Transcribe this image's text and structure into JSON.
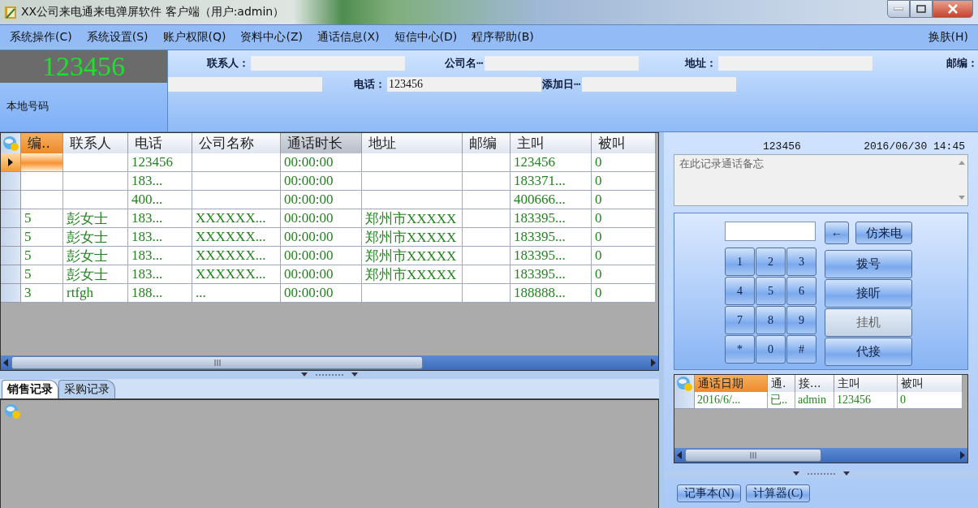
{
  "window": {
    "title": "XX公司来电通来电弹屏软件 客户端（用户:admin）"
  },
  "menu": {
    "items": [
      "系统操作(C)",
      "系统设置(S)",
      "账户权限(Q)",
      "资料中心(Z)",
      "通话信息(X)",
      "短信中心(D)",
      "程序帮助(B)"
    ],
    "skin": "换肤(H)"
  },
  "caller": {
    "number": "123456",
    "label": "本地号码"
  },
  "contact_form": {
    "rows": [
      [
        {
          "kind": "labeled",
          "label": "联系人："
        },
        {
          "kind": "labeled",
          "label": "公司名┅"
        },
        {
          "kind": "labeled",
          "label": "地址："
        },
        {
          "kind": "label",
          "label": "邮编："
        }
      ],
      [
        {
          "kind": "field"
        },
        {
          "kind": "labeled",
          "label": "电话：",
          "value": "123456"
        },
        {
          "kind": "labeled",
          "label": "添加日┅"
        }
      ]
    ]
  },
  "calls_table": {
    "columns": [
      {
        "label": "编..",
        "selected": true,
        "sorted": false
      },
      {
        "label": "联系人",
        "selected": false,
        "sorted": false
      },
      {
        "label": "电话",
        "selected": false,
        "sorted": false
      },
      {
        "label": "公司名称",
        "selected": false,
        "sorted": false
      },
      {
        "label": "通话时长",
        "selected": false,
        "sorted": true
      },
      {
        "label": "地址",
        "selected": false,
        "sorted": false
      },
      {
        "label": "邮编",
        "selected": false,
        "sorted": false
      },
      {
        "label": "主叫",
        "selected": false,
        "sorted": false
      },
      {
        "label": "被叫",
        "selected": false,
        "sorted": false
      }
    ],
    "rows": [
      {
        "selected": true,
        "cells": [
          "",
          "",
          "123456",
          "",
          "00:00:00",
          "",
          "",
          "123456",
          "0"
        ]
      },
      {
        "selected": false,
        "cells": [
          "",
          "",
          "183...",
          "",
          "00:00:00",
          "",
          "",
          "183371...",
          "0"
        ]
      },
      {
        "selected": false,
        "cells": [
          "",
          "",
          "400...",
          "",
          "00:00:00",
          "",
          "",
          "400666...",
          "0"
        ]
      },
      {
        "selected": false,
        "cells": [
          "5",
          "彭女士",
          "183...",
          "XXXXXX...",
          "00:00:00",
          "郑州市XXXXX",
          "",
          "183395...",
          "0"
        ]
      },
      {
        "selected": false,
        "cells": [
          "5",
          "彭女士",
          "183...",
          "XXXXXX...",
          "00:00:00",
          "郑州市XXXXX",
          "",
          "183395...",
          "0"
        ]
      },
      {
        "selected": false,
        "cells": [
          "5",
          "彭女士",
          "183...",
          "XXXXXX...",
          "00:00:00",
          "郑州市XXXXX",
          "",
          "183395...",
          "0"
        ]
      },
      {
        "selected": false,
        "cells": [
          "5",
          "彭女士",
          "183...",
          "XXXXXX...",
          "00:00:00",
          "郑州市XXXXX",
          "",
          "183395...",
          "0"
        ]
      },
      {
        "selected": false,
        "cells": [
          "3",
          "rtfgh",
          "188...",
          "...",
          "00:00:00",
          "",
          "",
          "188888...",
          "0"
        ]
      }
    ]
  },
  "record_tabs": [
    {
      "label": "销售记录",
      "selected": true
    },
    {
      "label": "采购记录",
      "selected": false
    }
  ],
  "call_info": {
    "number": "123456",
    "datetime": "2016/06/30 14:45",
    "memo_placeholder": "在此记录通话备忘"
  },
  "dialpad": {
    "backspace": "←",
    "simulate": "仿来电",
    "keys": [
      "1",
      "2",
      "3",
      "4",
      "5",
      "6",
      "7",
      "8",
      "9",
      "*",
      "0",
      "#"
    ],
    "actions": [
      {
        "label": "拨号",
        "disabled": false
      },
      {
        "label": "接听",
        "disabled": false
      },
      {
        "label": "挂机",
        "disabled": true
      },
      {
        "label": "代接",
        "disabled": false
      }
    ]
  },
  "history_table": {
    "columns": [
      {
        "label": "通话日期",
        "selected": true
      },
      {
        "label": "通.",
        "selected": false
      },
      {
        "label": "接...",
        "selected": false
      },
      {
        "label": "主叫",
        "selected": false
      },
      {
        "label": "被叫",
        "selected": false
      }
    ],
    "rows": [
      {
        "cells": [
          "2016/6/...",
          "已..",
          "admin",
          "123456",
          "0"
        ]
      }
    ]
  },
  "tools": [
    "记事本(N)",
    "计算器(C)"
  ]
}
